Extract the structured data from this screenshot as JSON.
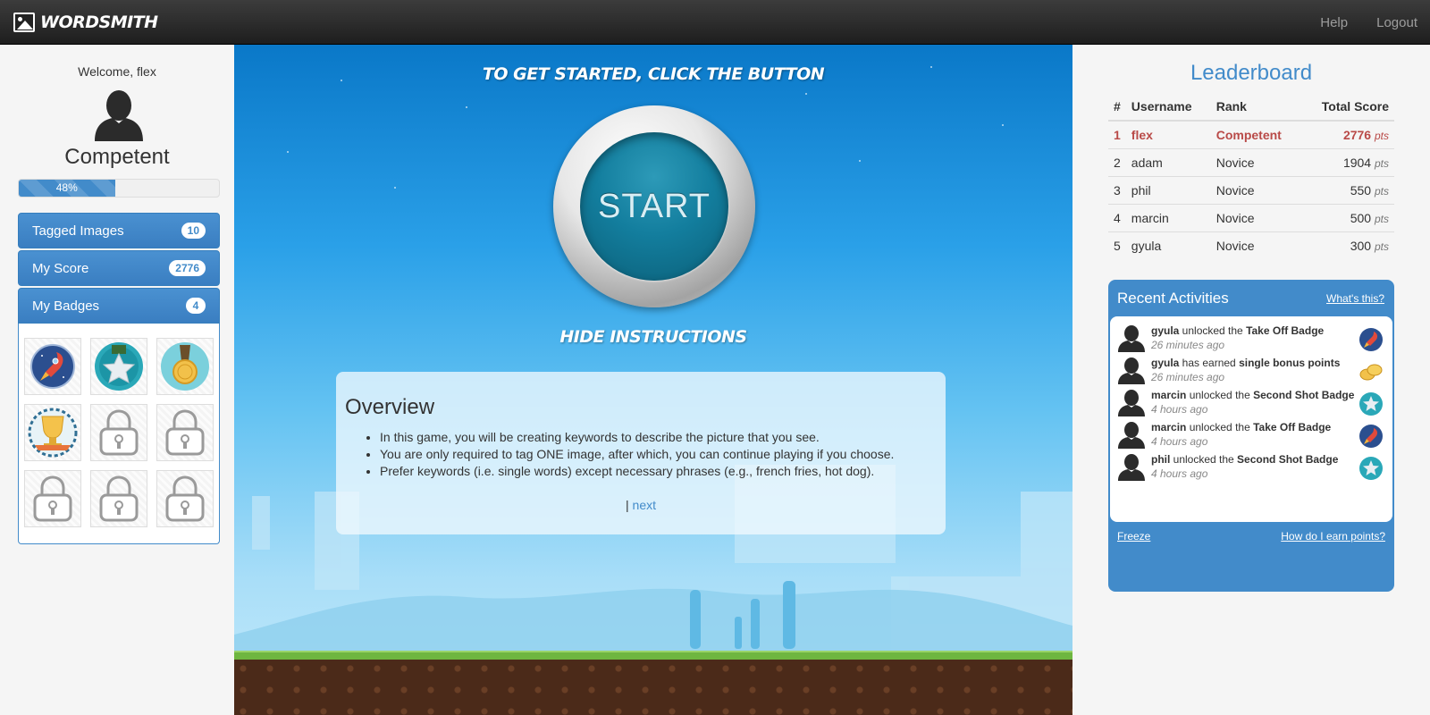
{
  "nav": {
    "brand": "WORDSMITH",
    "links": [
      "Help",
      "Logout"
    ]
  },
  "profile": {
    "welcome": "Welcome, flex",
    "rank": "Competent",
    "progress_percent": 48,
    "progress_label": "48%"
  },
  "sidebar": {
    "items": [
      {
        "label": "Tagged Images",
        "count": "10"
      },
      {
        "label": "My Score",
        "count": "2776"
      },
      {
        "label": "My Badges",
        "count": "4"
      }
    ],
    "badges": [
      "rocket-badge",
      "star-badge",
      "medal-badge",
      "trophy-badge",
      "locked",
      "locked",
      "locked",
      "locked",
      "locked"
    ]
  },
  "game": {
    "heading": "TO GET STARTED, CLICK THE BUTTON",
    "start_label": "START",
    "hide_label": "HIDE INSTRUCTIONS",
    "overview": {
      "title": "Overview",
      "points": [
        "In this game, you will be creating keywords to describe the picture that you see.",
        "You are only required to tag ONE image, after which, you can continue playing if you choose.",
        "Prefer keywords (i.e. single words) except necessary phrases (e.g., french fries, hot dog)."
      ],
      "pager_sep": "|",
      "next": "next"
    }
  },
  "leaderboard": {
    "title": "Leaderboard",
    "headers": [
      "#",
      "Username",
      "Rank",
      "Total Score"
    ],
    "unit": "pts",
    "rows": [
      {
        "n": "1",
        "user": "flex",
        "rank": "Competent",
        "score": "2776"
      },
      {
        "n": "2",
        "user": "adam",
        "rank": "Novice",
        "score": "1904"
      },
      {
        "n": "3",
        "user": "phil",
        "rank": "Novice",
        "score": "550"
      },
      {
        "n": "4",
        "user": "marcin",
        "rank": "Novice",
        "score": "500"
      },
      {
        "n": "5",
        "user": "gyula",
        "rank": "Novice",
        "score": "300"
      }
    ]
  },
  "activities": {
    "title": "Recent Activities",
    "help": "What's this?",
    "items": [
      {
        "user": "gyula",
        "verb": " unlocked the ",
        "object": "Take Off Badge",
        "time": "26 minutes ago",
        "icon": "rocket-icon"
      },
      {
        "user": "gyula",
        "verb": " has earned ",
        "object": "single bonus points",
        "time": "26 minutes ago",
        "icon": "coins-icon"
      },
      {
        "user": "marcin",
        "verb": " unlocked the ",
        "object": "Second Shot Badge",
        "time": "4 hours ago",
        "icon": "star-icon"
      },
      {
        "user": "marcin",
        "verb": " unlocked the ",
        "object": "Take Off Badge",
        "time": "4 hours ago",
        "icon": "rocket-icon"
      },
      {
        "user": "phil",
        "verb": " unlocked the ",
        "object": "Second Shot Badge",
        "time": "4 hours ago",
        "icon": "star-icon"
      }
    ],
    "footer_left": "Freeze",
    "footer_right": "How do I earn points?"
  },
  "colors": {
    "primary": "#428bca",
    "highlight": "#b94a48",
    "navbar": "#2a2a2a"
  }
}
